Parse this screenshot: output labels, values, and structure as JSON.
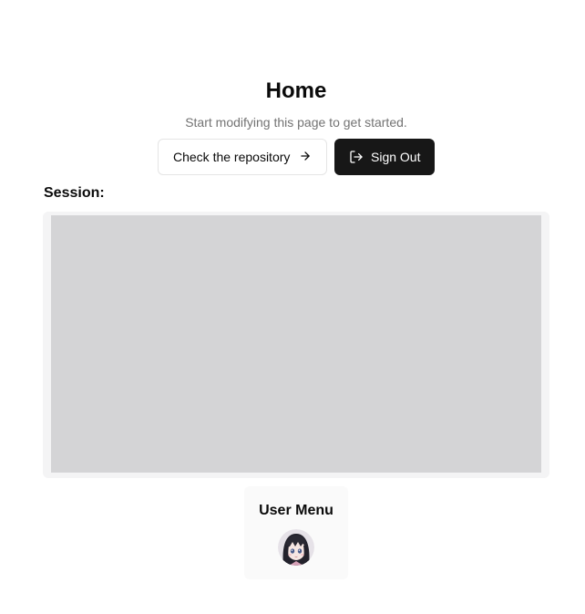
{
  "header": {
    "title": "Home",
    "subtitle": "Start modifying this page to get started."
  },
  "actions": {
    "repo_label": "Check the repository",
    "repo_icon": "arrow-right-icon",
    "signout_label": "Sign Out",
    "signout_icon": "log-out-icon"
  },
  "session": {
    "label": "Session:"
  },
  "user_menu": {
    "title": "User Menu",
    "avatar": "anime-avatar"
  },
  "colors": {
    "primary_button": "#171717",
    "session_panel": "#d4d4d6",
    "muted_text": "#737373"
  }
}
